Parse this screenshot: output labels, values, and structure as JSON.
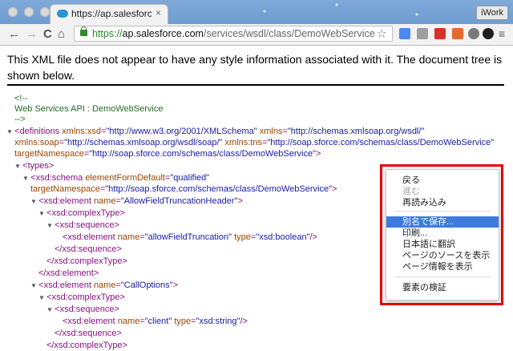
{
  "window": {
    "tab_title": "https://ap.salesforce.com/s",
    "tab_close": "×",
    "profile_label": "iWork"
  },
  "toolbar": {
    "back": "←",
    "forward": "→",
    "reload": "C",
    "home": "⌂",
    "url_protocol": "https://",
    "url_host": "ap.salesforce.com",
    "url_path": "/services/wsdl/class/DemoWebService",
    "bookmark_star": "☆",
    "menu": "≡"
  },
  "banner": {
    "text": "This XML file does not appear to have any style information associated with it. The document tree is shown below."
  },
  "xml_lines": [
    {
      "id": "l0",
      "arrow": "",
      "parts": [
        {
          "t": "<!--",
          "c": "comment"
        }
      ]
    },
    {
      "id": "l1",
      "arrow": "",
      "parts": [
        {
          "t": "Web Services API : DemoWebService",
          "c": "comment"
        }
      ]
    },
    {
      "id": "l2",
      "arrow": "",
      "parts": [
        {
          "t": "-->",
          "c": "comment"
        }
      ]
    },
    {
      "id": "l3",
      "arrow": "▼",
      "parts": [
        {
          "t": "<definitions ",
          "c": "tag"
        },
        {
          "t": "xmlns:xsd",
          "c": "attr"
        },
        {
          "t": "=",
          "c": "tag"
        },
        {
          "t": "\"http://www.w3.org/2001/XMLSchema\"",
          "c": "val"
        },
        {
          "t": " xmlns",
          "c": "attr"
        },
        {
          "t": "=",
          "c": "tag"
        },
        {
          "t": "\"http://schemas.xmlsoap.org/wsdl/\"",
          "c": "val"
        }
      ]
    },
    {
      "id": "l4",
      "arrow": "",
      "parts": [
        {
          "t": "xmlns:soap",
          "c": "attr"
        },
        {
          "t": "=",
          "c": "tag"
        },
        {
          "t": "\"http://schemas.xmlsoap.org/wsdl/soap/\"",
          "c": "val"
        },
        {
          "t": " xmlns:tns",
          "c": "attr"
        },
        {
          "t": "=",
          "c": "tag"
        },
        {
          "t": "\"http://soap.sforce.com/schemas/class/DemoWebService\"",
          "c": "val"
        }
      ]
    },
    {
      "id": "l5",
      "arrow": "",
      "parts": [
        {
          "t": "targetNamespace",
          "c": "attr"
        },
        {
          "t": "=",
          "c": "tag"
        },
        {
          "t": "\"http://soap.sforce.com/schemas/class/DemoWebService\"",
          "c": "val"
        },
        {
          "t": ">",
          "c": "tag"
        }
      ]
    },
    {
      "id": "l6",
      "arrow": "▼",
      "parts": [
        {
          "t": "<types>",
          "c": "tag"
        }
      ]
    },
    {
      "id": "l7",
      "arrow": "▼",
      "parts": [
        {
          "t": "<xsd:schema ",
          "c": "tag"
        },
        {
          "t": "elementFormDefault",
          "c": "attr"
        },
        {
          "t": "=",
          "c": "tag"
        },
        {
          "t": "\"qualified\"",
          "c": "val"
        }
      ]
    },
    {
      "id": "l8",
      "arrow": "",
      "parts": [
        {
          "t": "targetNamespace",
          "c": "attr"
        },
        {
          "t": "=",
          "c": "tag"
        },
        {
          "t": "\"http://soap.sforce.com/schemas/class/DemoWebService\"",
          "c": "val"
        },
        {
          "t": ">",
          "c": "tag"
        }
      ]
    },
    {
      "id": "l9",
      "arrow": "▼",
      "parts": [
        {
          "t": "<xsd:element ",
          "c": "tag"
        },
        {
          "t": "name",
          "c": "attr"
        },
        {
          "t": "=",
          "c": "tag"
        },
        {
          "t": "\"AllowFieldTruncationHeader\"",
          "c": "val"
        },
        {
          "t": ">",
          "c": "tag"
        }
      ]
    },
    {
      "id": "l10",
      "arrow": "▼",
      "parts": [
        {
          "t": "<xsd:complexType>",
          "c": "tag"
        }
      ]
    },
    {
      "id": "l11",
      "arrow": "▼",
      "parts": [
        {
          "t": "<xsd:sequence>",
          "c": "tag"
        }
      ]
    },
    {
      "id": "l12",
      "arrow": "",
      "parts": [
        {
          "t": "<xsd:element ",
          "c": "tag"
        },
        {
          "t": "name",
          "c": "attr"
        },
        {
          "t": "=",
          "c": "tag"
        },
        {
          "t": "\"allowFieldTruncation\"",
          "c": "val"
        },
        {
          "t": " type",
          "c": "attr"
        },
        {
          "t": "=",
          "c": "tag"
        },
        {
          "t": "\"xsd:boolean\"",
          "c": "val"
        },
        {
          "t": "/>",
          "c": "tag"
        }
      ]
    },
    {
      "id": "l13",
      "arrow": "",
      "parts": [
        {
          "t": "</xsd:sequence>",
          "c": "tag"
        }
      ]
    },
    {
      "id": "l14",
      "arrow": "",
      "parts": [
        {
          "t": "</xsd:complexType>",
          "c": "tag"
        }
      ]
    },
    {
      "id": "l15",
      "arrow": "",
      "parts": [
        {
          "t": "</xsd:element>",
          "c": "tag"
        }
      ]
    },
    {
      "id": "l16",
      "arrow": "▼",
      "parts": [
        {
          "t": "<xsd:element ",
          "c": "tag"
        },
        {
          "t": "name",
          "c": "attr"
        },
        {
          "t": "=",
          "c": "tag"
        },
        {
          "t": "\"CallOptions\"",
          "c": "val"
        },
        {
          "t": ">",
          "c": "tag"
        }
      ]
    },
    {
      "id": "l17",
      "arrow": "▼",
      "parts": [
        {
          "t": "<xsd:complexType>",
          "c": "tag"
        }
      ]
    },
    {
      "id": "l18",
      "arrow": "▼",
      "parts": [
        {
          "t": "<xsd:sequence>",
          "c": "tag"
        }
      ]
    },
    {
      "id": "l19",
      "arrow": "",
      "parts": [
        {
          "t": "<xsd:element ",
          "c": "tag"
        },
        {
          "t": "name",
          "c": "attr"
        },
        {
          "t": "=",
          "c": "tag"
        },
        {
          "t": "\"client\"",
          "c": "val"
        },
        {
          "t": " type",
          "c": "attr"
        },
        {
          "t": "=",
          "c": "tag"
        },
        {
          "t": "\"xsd:string\"",
          "c": "val"
        },
        {
          "t": "/>",
          "c": "tag"
        }
      ]
    },
    {
      "id": "l20",
      "arrow": "",
      "parts": [
        {
          "t": "</xsd:sequence>",
          "c": "tag"
        }
      ]
    },
    {
      "id": "l21",
      "arrow": "",
      "parts": [
        {
          "t": "</xsd:complexType>",
          "c": "tag"
        }
      ]
    }
  ],
  "context_menu": {
    "items": [
      {
        "label": "戻る",
        "state": "normal"
      },
      {
        "label": "進む",
        "state": "disabled"
      },
      {
        "label": "再読み込み",
        "state": "normal"
      },
      {
        "label": "別名で保存...",
        "state": "selected"
      },
      {
        "label": "印刷...",
        "state": "normal"
      },
      {
        "label": "日本語に翻訳",
        "state": "normal"
      },
      {
        "label": "ページのソースを表示",
        "state": "normal"
      },
      {
        "label": "ページ情報を表示",
        "state": "normal"
      },
      {
        "label": "要素の検証",
        "state": "normal"
      }
    ]
  },
  "colors": {
    "tag": "#881280",
    "attr": "#994500",
    "value": "#1a1aa6",
    "comment": "#236e25",
    "highlight_frame": "#e8000d",
    "menu_selection": "#3d7bde"
  }
}
